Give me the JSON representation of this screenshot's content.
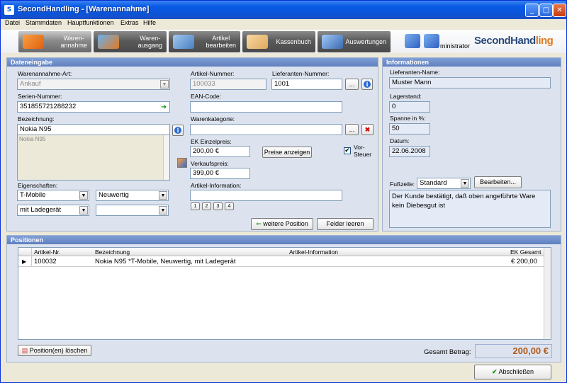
{
  "window": {
    "title": "SecondHandling - [Warenannahme]"
  },
  "menu": [
    "Datei",
    "Stammdaten",
    "Hauptfunktionen",
    "Extras",
    "Hilfe"
  ],
  "toolbar": {
    "items": [
      {
        "l1": "Waren-",
        "l2": "annahme"
      },
      {
        "l1": "Waren-",
        "l2": "ausgang"
      },
      {
        "l1": "Artikel",
        "l2": "bearbeiten"
      },
      {
        "l1": "Kassenbuch",
        "l2": ""
      },
      {
        "l1": "Auswertungen",
        "l2": ""
      }
    ],
    "admin_label": "ministrator",
    "logo_a": "SecondHand",
    "logo_b": "ling"
  },
  "dateneingabe": {
    "header": "Dateneingabe",
    "art_label": "Warenannahme-Art:",
    "art_value": "Ankauf",
    "serien_label": "Serien-Nummer:",
    "serien_value": "351855721288232",
    "bez_label": "Bezeichnung:",
    "bez_value": "Nokia N95",
    "bez_list": "Nokia N95",
    "eig_label": "Eigenschaften:",
    "eig1": "T-Mobile",
    "eig2": "Neuwertig",
    "eig3": "mit Ladegerät",
    "eig4": "",
    "artnr_label": "Artikel-Nummer:",
    "artnr_value": "100033",
    "lief_label": "Lieferanten-Nummer:",
    "lief_value": "1001",
    "ean_label": "EAN-Code:",
    "ean_value": "",
    "kat_label": "Warenkategorie:",
    "kat_value": "",
    "ek_label": "EK Einzelpreis:",
    "ek_value": "200,00 €",
    "preise_btn": "Preise anzeigen",
    "vorsteuer_l1": "Vor-",
    "vorsteuer_l2": "Steuer",
    "vk_label": "Verkaufspreis:",
    "vk_value": "399,00 €",
    "ainfo_label": "Artikel-Information:",
    "ainfo_value": "",
    "pages": [
      "1",
      "2",
      "3",
      "4"
    ],
    "weitere_btn": "weitere Position",
    "leeren_btn": "Felder leeren",
    "ellipsis": "..."
  },
  "informationen": {
    "header": "Informationen",
    "name_label": "Lieferanten-Name:",
    "name_value": "Muster  Mann",
    "lager_label": "Lagerstand:",
    "lager_value": "0",
    "spanne_label": "Spanne in %:",
    "spanne_value": "50",
    "datum_label": "Datum:",
    "datum_value": "22.06.2008",
    "fuss_label": "Fußzeile:",
    "fuss_value": "Standard",
    "bearbeiten_btn": "Bearbeiten...",
    "fuss_text": "Der Kunde bestätigt, daß oben angeführte Ware kein Diebesgut ist"
  },
  "positionen": {
    "header": "Positionen",
    "columns": [
      "Artikel-Nr.",
      "Bezeichnung",
      "Artikel-Information",
      "EK Gesamt"
    ],
    "rows": [
      {
        "nr": "100032",
        "bez": "Nokia N95 *T-Mobile, Neuwertig, mit Ladegerät",
        "info": "",
        "ek": "€ 200,00"
      }
    ],
    "loeschen_btn": "Position(en) löschen",
    "gesamt_label": "Gesamt Betrag:",
    "gesamt_value": "200,00 €"
  },
  "footer": {
    "close_btn": "Abschließen"
  },
  "colors": {
    "accent": "#0a5ce6",
    "total": "#b05a1a",
    "panel_header": "#6f8fcf"
  }
}
